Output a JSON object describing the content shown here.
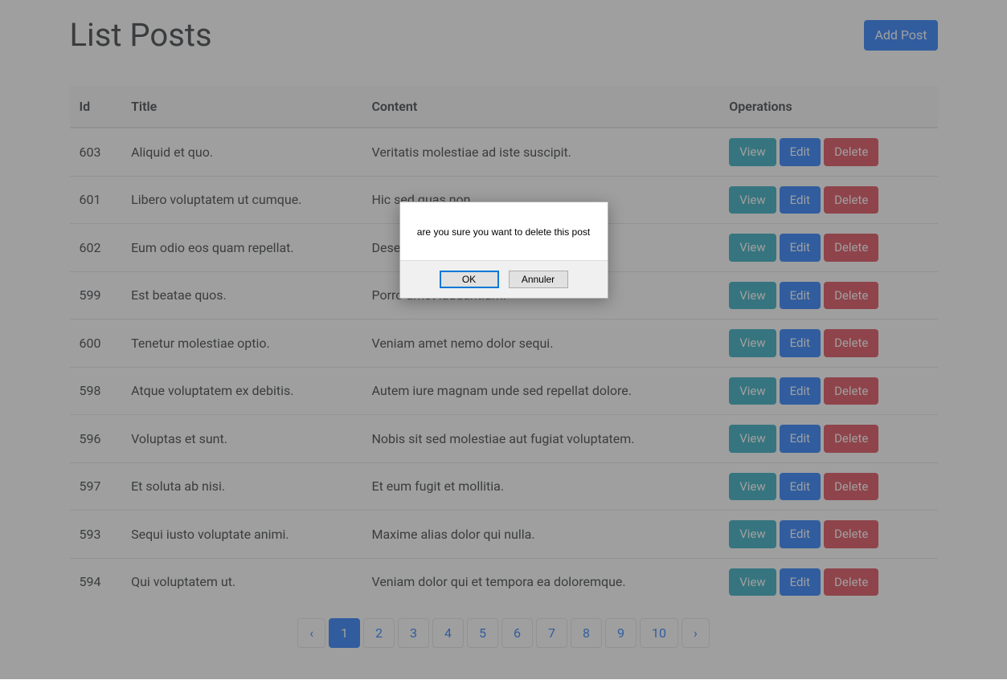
{
  "header": {
    "title": "List Posts",
    "add_button": "Add Post"
  },
  "table": {
    "headers": {
      "id": "Id",
      "title": "Title",
      "content": "Content",
      "operations": "Operations"
    },
    "rows": [
      {
        "id": "603",
        "title": "Aliquid et quo.",
        "content": "Veritatis molestiae ad iste suscipit."
      },
      {
        "id": "601",
        "title": "Libero voluptatem ut cumque.",
        "content": "Hic sed quas non."
      },
      {
        "id": "602",
        "title": "Eum odio eos quam repellat.",
        "content": "Deserunt non sit."
      },
      {
        "id": "599",
        "title": "Est beatae quos.",
        "content": "Porro amet laudantium."
      },
      {
        "id": "600",
        "title": "Tenetur molestiae optio.",
        "content": "Veniam amet nemo dolor sequi."
      },
      {
        "id": "598",
        "title": "Atque voluptatem ex debitis.",
        "content": "Autem iure magnam unde sed repellat dolore."
      },
      {
        "id": "596",
        "title": "Voluptas et sunt.",
        "content": "Nobis sit sed molestiae aut fugiat voluptatem."
      },
      {
        "id": "597",
        "title": "Et soluta ab nisi.",
        "content": "Et eum fugit et mollitia."
      },
      {
        "id": "593",
        "title": "Sequi iusto voluptate animi.",
        "content": "Maxime alias dolor qui nulla."
      },
      {
        "id": "594",
        "title": "Qui voluptatem ut.",
        "content": "Veniam dolor qui et tempora ea doloremque."
      }
    ]
  },
  "buttons": {
    "view": "View",
    "edit": "Edit",
    "delete": "Delete"
  },
  "pagination": {
    "prev": "‹",
    "next": "›",
    "pages": [
      "1",
      "2",
      "3",
      "4",
      "5",
      "6",
      "7",
      "8",
      "9",
      "10"
    ],
    "active": "1"
  },
  "dialog": {
    "message": "are you sure you want to delete this post",
    "ok": "OK",
    "cancel": "Annuler"
  }
}
